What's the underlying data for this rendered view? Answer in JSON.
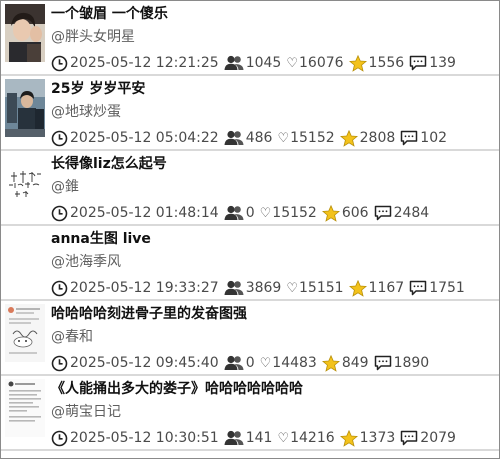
{
  "items": [
    {
      "title": "一个皱眉 一个傻乐",
      "author": "@胖头女明星",
      "time": "2025-05-12 12:21:25",
      "views": "1045",
      "likes": "16076",
      "favorites": "1556",
      "comments": "139",
      "thumb": "photo-portrait"
    },
    {
      "title": "25岁 岁岁平安",
      "author": "@地球炒蛋",
      "time": "2025-05-12 05:04:22",
      "views": "486",
      "likes": "15152",
      "favorites": "2808",
      "comments": "102",
      "thumb": "photo-street"
    },
    {
      "title": "长得像liz怎么起号",
      "author": "@錐",
      "time": "2025-05-12 01:48:14",
      "views": "0",
      "likes": "15152",
      "favorites": "606",
      "comments": "2484",
      "thumb": "handwritten-text"
    },
    {
      "title": "anna生图 live",
      "author": "@池海季风",
      "time": "2025-05-12 19:33:27",
      "views": "3869",
      "likes": "15151",
      "favorites": "1167",
      "comments": "1751",
      "thumb": "blank"
    },
    {
      "title": "哈哈哈哈刻进骨子里的发奋图强",
      "author": "@春和",
      "time": "2025-05-12 09:45:40",
      "views": "0",
      "likes": "14483",
      "favorites": "849",
      "comments": "1890",
      "thumb": "chat-screenshot"
    },
    {
      "title": "《人能捅出多大的娄子》哈哈哈哈哈哈哈",
      "author": "@萌宝日记",
      "time": "2025-05-12 10:30:51",
      "views": "141",
      "likes": "14216",
      "favorites": "1373",
      "comments": "2079",
      "thumb": "text-screenshot"
    }
  ],
  "icons": {
    "time": "clock-icon",
    "views": "people-icon",
    "likes": "heart-icon",
    "favorites": "star-icon",
    "comments": "comment-icon"
  },
  "colors": {
    "star": "#f3c21b",
    "divider": "#d9d9d9",
    "title": "#111111",
    "meta": "#4a4a4a"
  }
}
